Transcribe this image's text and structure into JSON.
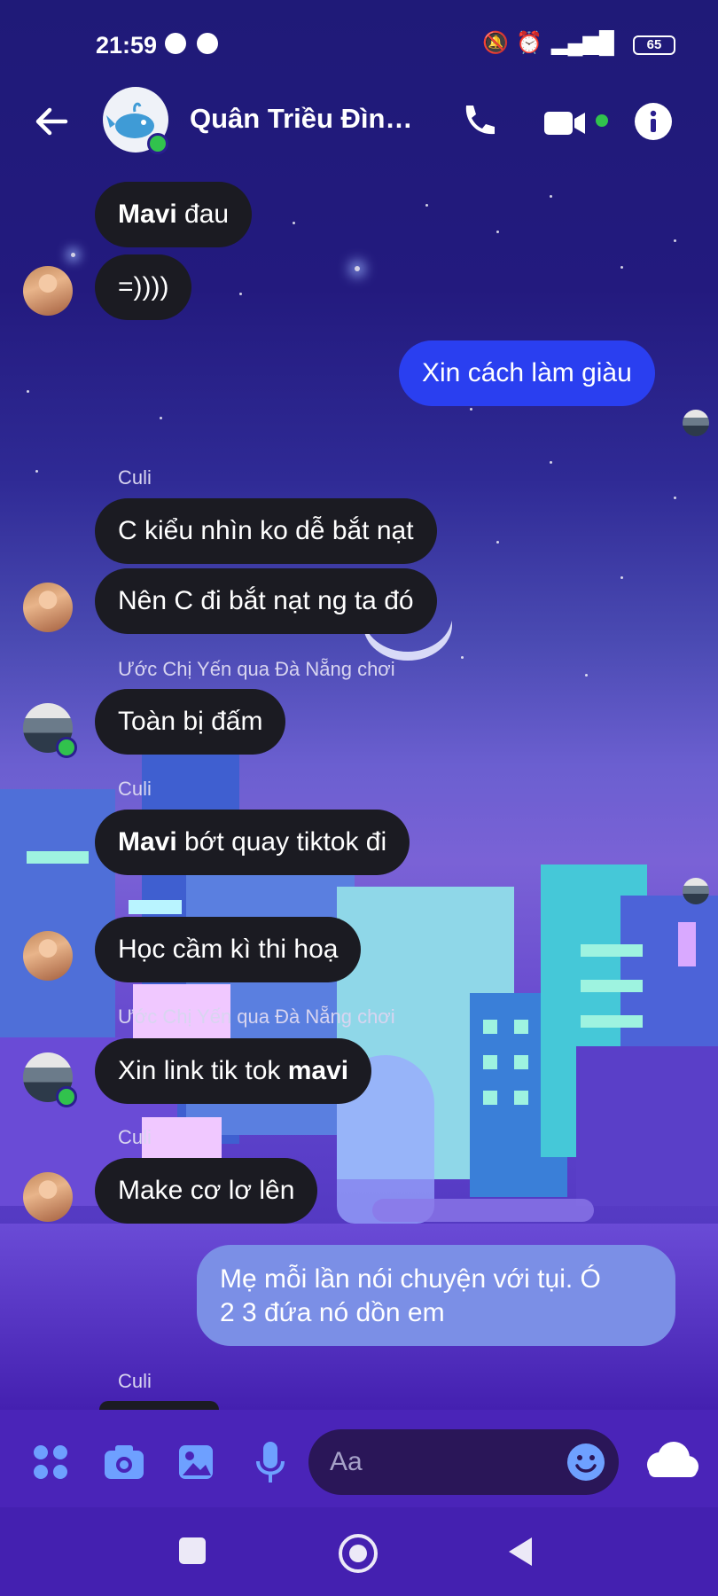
{
  "status_bar": {
    "time": "21:59",
    "battery": "65"
  },
  "header": {
    "title": "Quân Triều Đình..."
  },
  "messages": {
    "m1": {
      "bold": "Mavi",
      "text": " đau"
    },
    "m2": {
      "text": "=))))"
    },
    "m3": {
      "text": "Xin cách làm giàu"
    },
    "sender1": "Culi",
    "m4": {
      "text": "C kiểu nhìn ko dễ bắt nạt"
    },
    "m5": {
      "text": "Nên C đi bắt nạt ng ta đó"
    },
    "sender2": "Ước Chị Yến qua Đà Nẵng chơi",
    "m6": {
      "text": "Toàn bị đấm"
    },
    "sender3": "Culi",
    "m7": {
      "bold": "Mavi",
      "text": " bớt quay tiktok đi"
    },
    "m8": {
      "text": "Học cầm kì thi hoạ"
    },
    "sender4": "Ước Chị Yến qua Đà Nẵng chơi",
    "m9": {
      "text": "Xin link tik tok ",
      "bold": "mavi"
    },
    "sender5": "Culi",
    "m10": {
      "text": "Make cơ lơ lên"
    },
    "m11": {
      "line1": "Mẹ mỗi lần nói chuyện với tụi. Ó",
      "line2": "2 3 đứa nó dồn em"
    },
    "sender6": "Culi"
  },
  "composer": {
    "placeholder": "Aa"
  },
  "colors": {
    "outgoing": "#2a3ff0",
    "incoming": "#1b1b22",
    "outgoing_light": "#7b8fe6",
    "online": "#31c24d"
  }
}
